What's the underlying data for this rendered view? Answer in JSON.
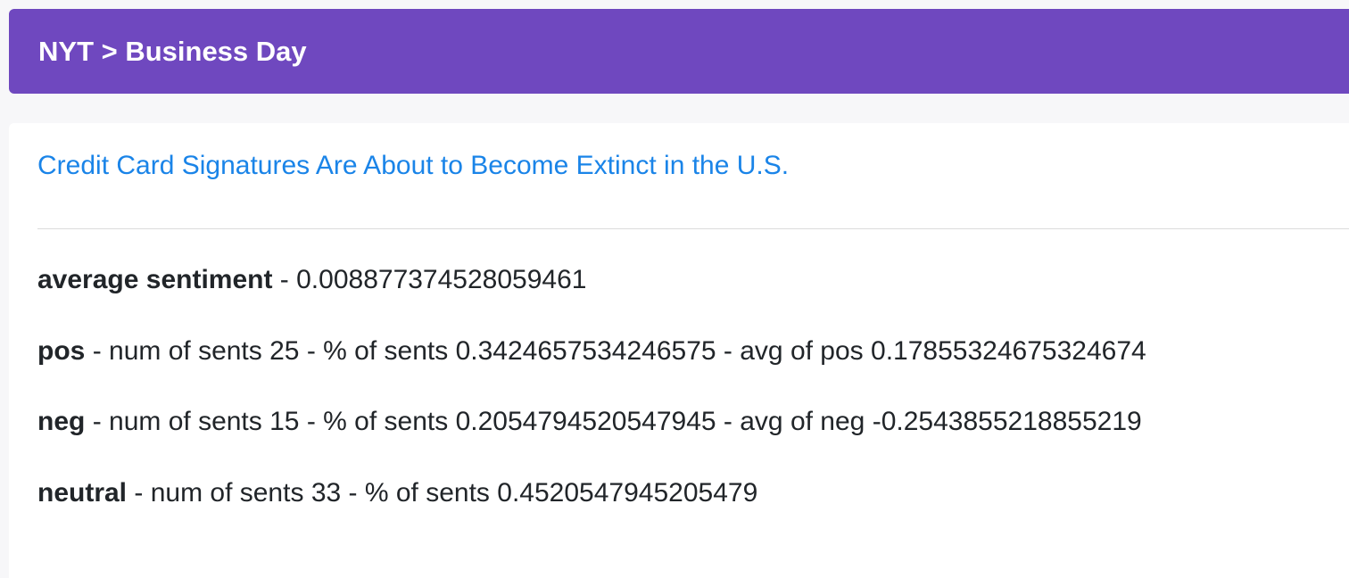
{
  "header": {
    "title": "NYT > Business Day"
  },
  "article": {
    "title": "Credit Card Signatures Are About to Become Extinct in the U.S."
  },
  "stats": {
    "average": {
      "label": "average sentiment",
      "value": "0.008877374528059461"
    },
    "pos": {
      "label": "pos",
      "num_label": "num of sents",
      "num": "25",
      "pct_label": "% of sents",
      "pct": "0.3424657534246575",
      "avg_label": "avg of pos",
      "avg": "0.17855324675324674"
    },
    "neg": {
      "label": "neg",
      "num_label": "num of sents",
      "num": "15",
      "pct_label": "% of sents",
      "pct": "0.2054794520547945",
      "avg_label": "avg of neg",
      "avg": "-0.2543855218855219"
    },
    "neutral": {
      "label": "neutral",
      "num_label": "num of sents",
      "num": "33",
      "pct_label": "% of sents",
      "pct": "0.4520547945205479"
    }
  },
  "colors": {
    "header_bg": "#6f48bf",
    "link": "#1a84e8",
    "text": "#212529"
  }
}
